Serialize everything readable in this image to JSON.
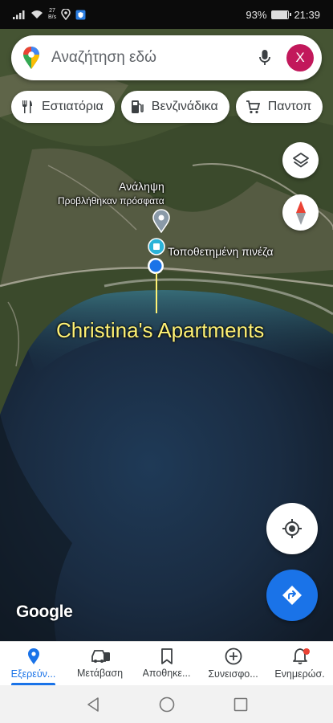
{
  "status_bar": {
    "speed_value": "27",
    "speed_unit": "B/s",
    "battery": "93%",
    "battery_level": 0.93,
    "time": "21:39"
  },
  "search": {
    "placeholder": "Αναζήτηση εδώ",
    "avatar_letter": "X",
    "avatar_color": "#c2185b"
  },
  "chips": [
    {
      "label": "Εστιατόρια",
      "icon": "restaurant-icon"
    },
    {
      "label": "Βενζινάδικα",
      "icon": "gas-station-icon"
    },
    {
      "label": "Παντοπ",
      "icon": "shopping-cart-icon"
    }
  ],
  "map": {
    "place_label": "Ανάληψη",
    "recent_label": "Προβλήθηκαν πρόσφατα",
    "pin_label": "Τοποθετημένη πινέζα",
    "annotation": "Christina's Apartments",
    "annotation_color": "#fff275",
    "logo": "Google"
  },
  "bottom_nav": [
    {
      "label": "Εξερεύν...",
      "icon": "explore-pin-icon",
      "active": true
    },
    {
      "label": "Μετάβαση",
      "icon": "car-icon",
      "active": false
    },
    {
      "label": "Αποθηκε...",
      "icon": "bookmark-icon",
      "active": false
    },
    {
      "label": "Συνεισφο...",
      "icon": "add-circle-icon",
      "active": false
    },
    {
      "label": "Ενημερώσ.",
      "icon": "bell-icon",
      "active": false
    }
  ],
  "colors": {
    "accent": "#1a73e8",
    "notification": "#ea4335"
  }
}
